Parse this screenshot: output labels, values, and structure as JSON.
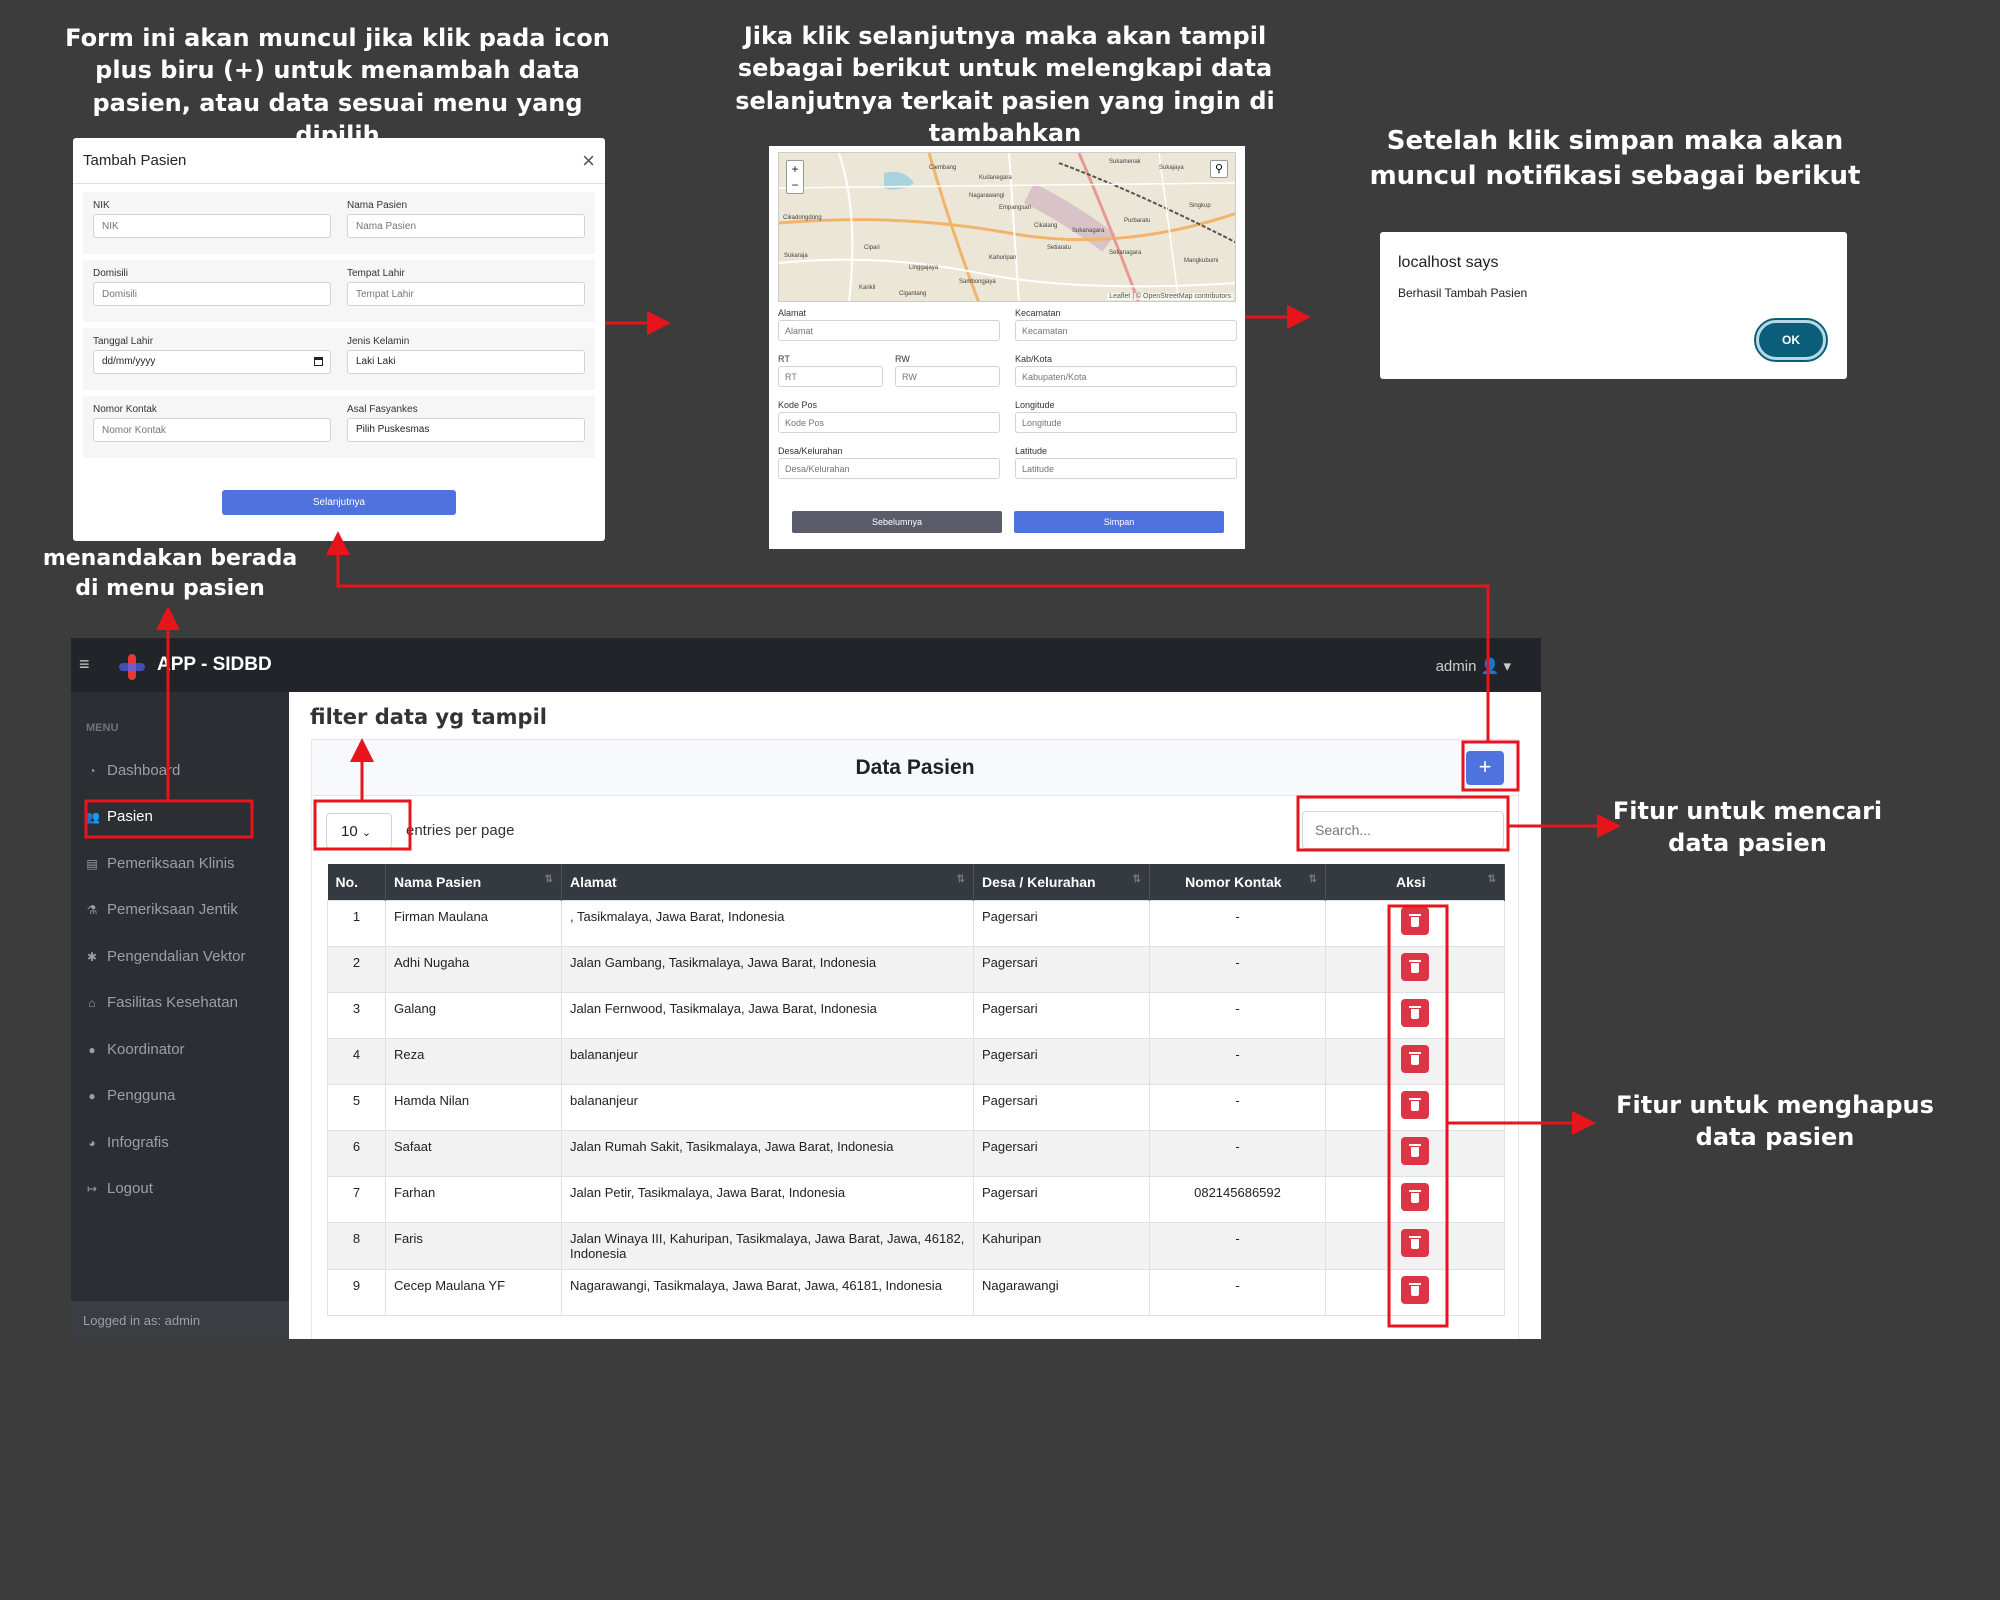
{
  "annotations": {
    "form_info": "Form ini akan muncul jika klik pada icon plus biru (+) untuk menambah data pasien, atau data sesuai menu yang dipilih",
    "next_info": "Jika klik selanjutnya maka akan tampil sebagai berikut untuk melengkapi data selanjutnya terkait pasien yang ingin di tambahkan",
    "save_info": "Setelah klik simpan maka akan muncul notifikasi sebagai berikut",
    "menu_info": "menandakan berada di menu pasien",
    "filter_info": "filter data yg tampil",
    "search_info": "Fitur untuk mencari data pasien",
    "delete_info": "Fitur untuk menghapus data pasien"
  },
  "modal1": {
    "title": "Tambah Pasien",
    "fields": {
      "nik": {
        "label": "NIK",
        "placeholder": "NIK"
      },
      "nama": {
        "label": "Nama Pasien",
        "placeholder": "Nama Pasien"
      },
      "domisili": {
        "label": "Domisili",
        "placeholder": "Domisili"
      },
      "tempat": {
        "label": "Tempat Lahir",
        "placeholder": "Tempat Lahir"
      },
      "tanggal": {
        "label": "Tanggal Lahir",
        "value": "dd/mm/yyyy"
      },
      "jk": {
        "label": "Jenis Kelamin",
        "value": "Laki Laki"
      },
      "kontak": {
        "label": "Nomor Kontak",
        "placeholder": "Nomor Kontak"
      },
      "faskes": {
        "label": "Asal Fasyankes",
        "value": "Pilih Puskesmas"
      }
    },
    "next_button": "Selanjutnya"
  },
  "modal2": {
    "map_labels": [
      "Ciembang",
      "Sukamenak",
      "Sukajaya",
      "Kudanegara",
      "Nagarawangi",
      "Empangsari",
      "Cikalang",
      "Sukanagara",
      "Purbaratu",
      "Singkup",
      "Cikadongdong",
      "Cipari",
      "Linggajaya",
      "Kahuripan",
      "Setiaratu",
      "Setianagara",
      "Mangkubumi",
      "Sukaraja",
      "Sambongjaya",
      "Karikil",
      "Cigantang"
    ],
    "map_attribution": "Leaflet | © OpenStreetMap contributors",
    "fields": {
      "alamat": {
        "label": "Alamat",
        "placeholder": "Alamat"
      },
      "kecamatan": {
        "label": "Kecamatan",
        "placeholder": "Kecamatan"
      },
      "rt": {
        "label": "RT",
        "placeholder": "RT"
      },
      "rw": {
        "label": "RW",
        "placeholder": "RW"
      },
      "kabkota": {
        "label": "Kab/Kota",
        "placeholder": "Kabupaten/Kota"
      },
      "kodepos": {
        "label": "Kode Pos",
        "placeholder": "Kode Pos"
      },
      "longitude": {
        "label": "Longitude",
        "placeholder": "Longitude"
      },
      "desa": {
        "label": "Desa/Kelurahan",
        "placeholder": "Desa/Kelurahan"
      },
      "latitude": {
        "label": "Latitude",
        "placeholder": "Latitude"
      }
    },
    "prev_button": "Sebelumnya",
    "save_button": "Simpan"
  },
  "alert": {
    "title": "localhost says",
    "message": "Berhasil Tambah Pasien",
    "ok": "OK"
  },
  "app": {
    "brand": "APP - SIDBD",
    "user": "admin",
    "menu_heading": "MENU",
    "menu": [
      {
        "label": "Dashboard",
        "icon": "dashboard-icon"
      },
      {
        "label": "Pasien",
        "icon": "users-icon",
        "active": true
      },
      {
        "label": "Pemeriksaan Klinis",
        "icon": "clipboard-icon"
      },
      {
        "label": "Pemeriksaan Jentik",
        "icon": "flask-icon"
      },
      {
        "label": "Pengendalian Vektor",
        "icon": "bug-icon"
      },
      {
        "label": "Fasilitas Kesehatan",
        "icon": "hospital-icon"
      },
      {
        "label": "Koordinator",
        "icon": "user-icon"
      },
      {
        "label": "Pengguna",
        "icon": "user-group-icon"
      },
      {
        "label": "Infografis",
        "icon": "chart-pie-icon"
      },
      {
        "label": "Logout",
        "icon": "logout-icon"
      }
    ],
    "logged_in": "Logged in as: admin",
    "card_title": "Data Pasien",
    "entries_value": "10",
    "entries_label": "entries per page",
    "search_placeholder": "Search...",
    "columns": [
      "No.",
      "Nama Pasien",
      "Alamat",
      "Desa / Kelurahan",
      "Nomor Kontak",
      "Aksi"
    ],
    "rows": [
      {
        "no": "1",
        "nama": "Firman Maulana",
        "alamat": ", Tasikmalaya, Jawa Barat, Indonesia",
        "desa": "Pagersari",
        "kontak": "-"
      },
      {
        "no": "2",
        "nama": "Adhi Nugaha",
        "alamat": "Jalan Gambang, Tasikmalaya, Jawa Barat, Indonesia",
        "desa": "Pagersari",
        "kontak": "-"
      },
      {
        "no": "3",
        "nama": "Galang",
        "alamat": "Jalan Fernwood, Tasikmalaya, Jawa Barat, Indonesia",
        "desa": "Pagersari",
        "kontak": "-"
      },
      {
        "no": "4",
        "nama": "Reza",
        "alamat": "balananjeur",
        "desa": "Pagersari",
        "kontak": "-"
      },
      {
        "no": "5",
        "nama": "Hamda Nilan",
        "alamat": "balananjeur",
        "desa": "Pagersari",
        "kontak": "-"
      },
      {
        "no": "6",
        "nama": "Safaat",
        "alamat": "Jalan Rumah Sakit, Tasikmalaya, Jawa Barat, Indonesia",
        "desa": "Pagersari",
        "kontak": "-"
      },
      {
        "no": "7",
        "nama": "Farhan",
        "alamat": "Jalan Petir, Tasikmalaya, Jawa Barat, Indonesia",
        "desa": "Pagersari",
        "kontak": "082145686592"
      },
      {
        "no": "8",
        "nama": "Faris",
        "alamat": "Jalan Winaya III, Kahuripan, Tasikmalaya, Jawa Barat, Jawa, 46182, Indonesia",
        "desa": "Kahuripan",
        "kontak": "-"
      },
      {
        "no": "9",
        "nama": "Cecep Maulana YF",
        "alamat": "Nagarawangi, Tasikmalaya, Jawa Barat, Jawa, 46181, Indonesia",
        "desa": "Nagarawangi",
        "kontak": "-"
      }
    ]
  }
}
